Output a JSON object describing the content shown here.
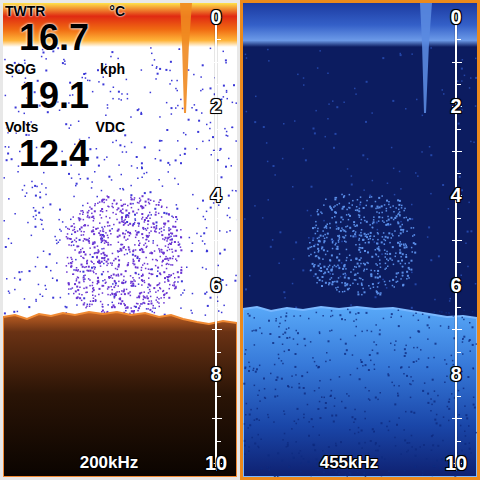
{
  "panels": [
    {
      "kind": "bronze",
      "frequency": "200kHz",
      "selected": false,
      "readings": [
        {
          "label": "TWTR",
          "unit": "°C",
          "value": "16.7"
        },
        {
          "label": "SOG",
          "unit": "kph",
          "value": "19.1"
        },
        {
          "label": "Volts",
          "unit": "VDC",
          "value": "12.4"
        }
      ]
    },
    {
      "kind": "blue",
      "frequency": "455kHz",
      "selected": true,
      "readings": []
    }
  ],
  "depth_scale": [
    "0",
    "2",
    "4",
    "6",
    "8",
    "10"
  ]
}
